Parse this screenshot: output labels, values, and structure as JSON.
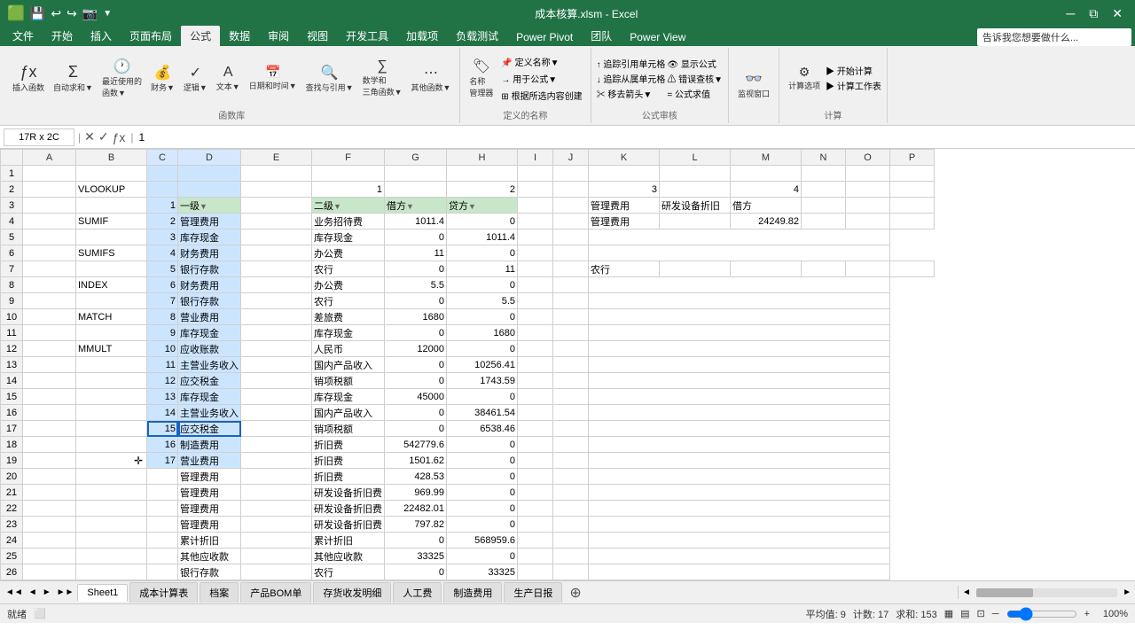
{
  "titleBar": {
    "title": "成本核算.xlsm - Excel",
    "saveIcon": "💾",
    "undoIcon": "↩",
    "redoIcon": "↪",
    "cameraIcon": "📷",
    "minimizeBtn": "─",
    "restoreBtn": "⧉",
    "closeBtn": "✕"
  },
  "ribbonTabs": [
    "文件",
    "开始",
    "插入",
    "页面布局",
    "公式",
    "数据",
    "审阅",
    "视图",
    "开发工具",
    "加载项",
    "负载测试",
    "Power Pivot",
    "团队",
    "Power View"
  ],
  "activeTab": "公式",
  "formulaBar": {
    "cellRef": "17R x 2C",
    "formula": "1"
  },
  "columnHeaders": [
    "",
    "A",
    "B",
    "C",
    "D",
    "E",
    "F",
    "G",
    "H",
    "I",
    "J",
    "K",
    "L",
    "M",
    "N",
    "O",
    "P"
  ],
  "rows": [
    {
      "num": 1,
      "cells": [
        "",
        "",
        "",
        "",
        "",
        "",
        "",
        "",
        "",
        "",
        "",
        "",
        "",
        "",
        "",
        "",
        ""
      ]
    },
    {
      "num": 2,
      "cells": [
        "",
        "VLOOKUP",
        "",
        "",
        "",
        "",
        "1",
        "",
        "2",
        "",
        "",
        "3",
        "",
        "4",
        "",
        "",
        ""
      ]
    },
    {
      "num": 3,
      "cells": [
        "",
        "",
        "",
        "",
        "1",
        "一级▼",
        "",
        "二级▼",
        "借方▼",
        "贷方▼",
        "",
        "",
        "",
        "",
        "",
        "",
        "",
        "借方"
      ]
    },
    {
      "num": 4,
      "cells": [
        "",
        "SUMIF",
        "",
        "",
        "2",
        "管理费用",
        "",
        "业务招待费",
        "1011.4",
        "0",
        "",
        "",
        "",
        "",
        "",
        "",
        "",
        "管理费用"
      ]
    },
    {
      "num": 5,
      "cells": [
        "",
        "",
        "",
        "",
        "3",
        "库存现金",
        "",
        "库存现金",
        "0",
        "1011.4",
        "",
        "",
        "",
        "",
        "",
        "",
        "",
        ""
      ]
    },
    {
      "num": 6,
      "cells": [
        "",
        "SUMIFS",
        "",
        "",
        "4",
        "财务费用",
        "",
        "办公费",
        "11",
        "0",
        "",
        "",
        "",
        "",
        "",
        "",
        "",
        ""
      ]
    },
    {
      "num": 7,
      "cells": [
        "",
        "",
        "",
        "",
        "5",
        "银行存款",
        "",
        "农行",
        "0",
        "11",
        "",
        "农行",
        "",
        "",
        "",
        "",
        "",
        ""
      ]
    },
    {
      "num": 8,
      "cells": [
        "",
        "INDEX",
        "",
        "",
        "6",
        "财务费用",
        "",
        "办公费",
        "5.5",
        "0",
        "",
        "",
        "",
        "",
        "",
        "",
        "",
        ""
      ]
    },
    {
      "num": 9,
      "cells": [
        "",
        "",
        "",
        "",
        "7",
        "银行存款",
        "",
        "农行",
        "0",
        "5.5",
        "",
        "",
        "",
        "",
        "",
        "",
        "",
        ""
      ]
    },
    {
      "num": 10,
      "cells": [
        "",
        "MATCH",
        "",
        "",
        "8",
        "营业费用",
        "",
        "差旅费",
        "1680",
        "0",
        "",
        "",
        "",
        "",
        "",
        "",
        "",
        ""
      ]
    },
    {
      "num": 11,
      "cells": [
        "",
        "",
        "",
        "",
        "9",
        "库存现金",
        "",
        "库存现金",
        "0",
        "1680",
        "",
        "",
        "",
        "",
        "",
        "",
        "",
        ""
      ]
    },
    {
      "num": 12,
      "cells": [
        "",
        "MMULT",
        "",
        "",
        "10",
        "应收账款",
        "",
        "人民币",
        "12000",
        "0",
        "",
        "",
        "",
        "",
        "",
        "",
        "",
        ""
      ]
    },
    {
      "num": 13,
      "cells": [
        "",
        "",
        "",
        "",
        "11",
        "主营业务收入",
        "",
        "国内产品收入",
        "0",
        "10256.41",
        "",
        "",
        "",
        "",
        "",
        "",
        "",
        ""
      ]
    },
    {
      "num": 14,
      "cells": [
        "",
        "",
        "",
        "",
        "12",
        "应交税金",
        "",
        "销项税额",
        "0",
        "1743.59",
        "",
        "",
        "",
        "",
        "",
        "",
        "",
        ""
      ]
    },
    {
      "num": 15,
      "cells": [
        "",
        "",
        "",
        "",
        "13",
        "库存现金",
        "",
        "库存现金",
        "45000",
        "0",
        "",
        "",
        "",
        "",
        "",
        "",
        "",
        ""
      ]
    },
    {
      "num": 16,
      "cells": [
        "",
        "",
        "",
        "",
        "14",
        "主营业务收入",
        "",
        "国内产品收入",
        "0",
        "38461.54",
        "",
        "",
        "",
        "",
        "",
        "",
        "",
        ""
      ]
    },
    {
      "num": 17,
      "cells": [
        "",
        "",
        "",
        "",
        "15",
        "应交税金",
        "",
        "销项税额",
        "0",
        "6538.46",
        "",
        "",
        "",
        "",
        "",
        "",
        "",
        ""
      ]
    },
    {
      "num": 18,
      "cells": [
        "",
        "",
        "",
        "",
        "16",
        "制造费用",
        "",
        "折旧费",
        "542779.6",
        "0",
        "",
        "",
        "",
        "",
        "",
        "",
        "",
        ""
      ]
    },
    {
      "num": 19,
      "cells": [
        "",
        "",
        "",
        "",
        "17",
        "营业费用",
        "",
        "折旧费",
        "1501.62",
        "0",
        "",
        "",
        "",
        "",
        "",
        "",
        "",
        ""
      ]
    },
    {
      "num": 20,
      "cells": [
        "",
        "",
        "",
        "",
        "",
        "管理费用",
        "",
        "折旧费",
        "428.53",
        "0",
        "",
        "",
        "",
        "",
        "",
        "",
        "",
        ""
      ]
    },
    {
      "num": 21,
      "cells": [
        "",
        "",
        "",
        "",
        "",
        "管理费用",
        "",
        "研发设备折旧费",
        "969.99",
        "0",
        "",
        "",
        "",
        "",
        "",
        "",
        "",
        ""
      ]
    },
    {
      "num": 22,
      "cells": [
        "",
        "",
        "",
        "",
        "",
        "管理费用",
        "",
        "研发设备折旧费",
        "22482.01",
        "0",
        "",
        "",
        "",
        "",
        "",
        "",
        "",
        ""
      ]
    },
    {
      "num": 23,
      "cells": [
        "",
        "",
        "",
        "",
        "",
        "管理费用",
        "",
        "研发设备折旧费",
        "797.82",
        "0",
        "",
        "",
        "",
        "",
        "",
        "",
        "",
        ""
      ]
    },
    {
      "num": 24,
      "cells": [
        "",
        "",
        "",
        "",
        "",
        "累计折旧",
        "",
        "累计折旧",
        "0",
        "568959.6",
        "",
        "",
        "",
        "",
        "",
        "",
        "",
        ""
      ]
    },
    {
      "num": 25,
      "cells": [
        "",
        "",
        "",
        "",
        "",
        "其他应收款",
        "",
        "其他应收款",
        "33325",
        "0",
        "",
        "",
        "",
        "",
        "",
        "",
        "",
        ""
      ]
    },
    {
      "num": 26,
      "cells": [
        "",
        "",
        "",
        "",
        "",
        "银行存款",
        "",
        "农行",
        "0",
        "33325",
        "",
        "",
        "",
        "",
        "",
        "",
        "",
        ""
      ]
    }
  ],
  "extraCells": {
    "K3": "管理费用",
    "L3": "研发设备折旧",
    "M3": "借方",
    "M4": "24249.82"
  },
  "sheetTabs": [
    "Sheet1",
    "成本计算表",
    "档案",
    "产品BOM单",
    "存货收发明细",
    "人工费",
    "制造费用",
    "生产日报"
  ],
  "activeSheet": "Sheet1",
  "statusBar": {
    "mode": "就绪",
    "average": "平均值: 9",
    "count": "计数: 17",
    "sum": "求和: 153",
    "zoom": "100%"
  }
}
